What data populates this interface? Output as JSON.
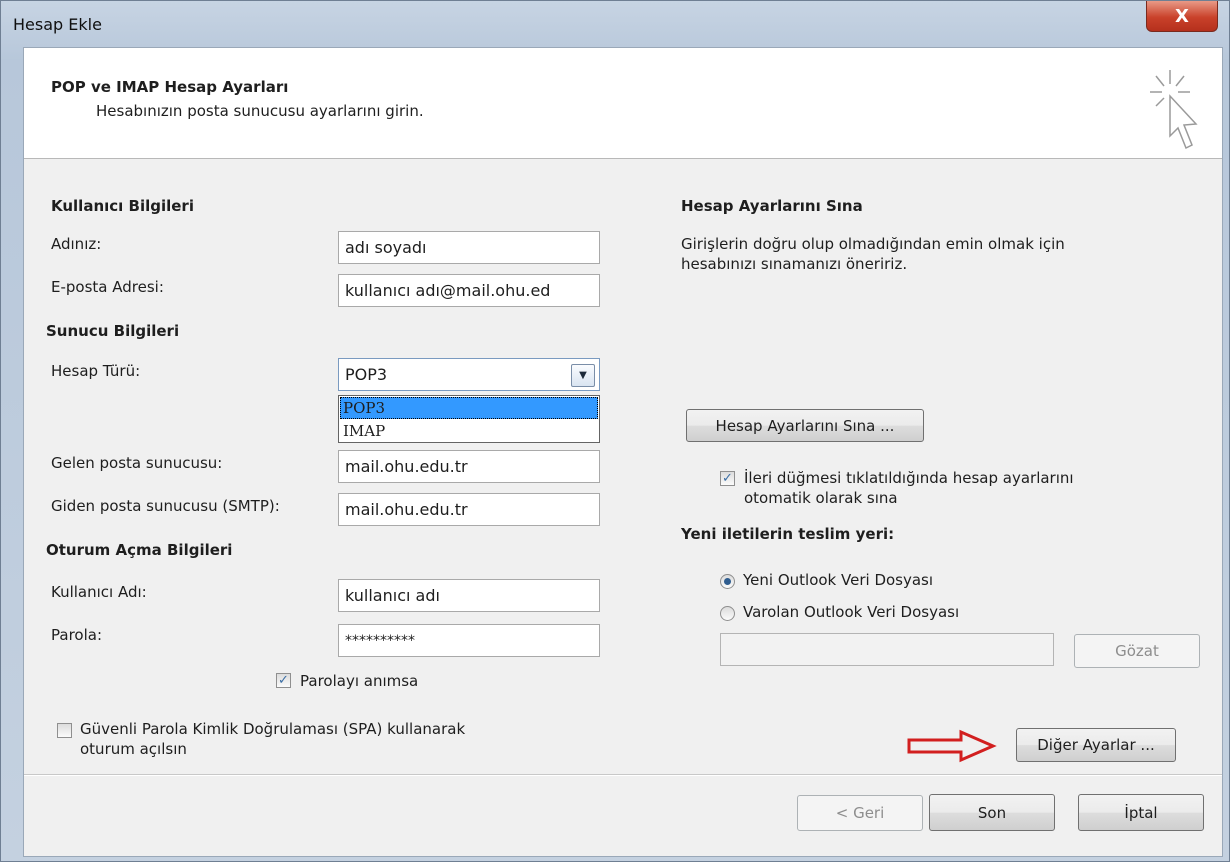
{
  "window": {
    "title": "Hesap Ekle",
    "close_label": "X"
  },
  "header": {
    "title": "POP ve IMAP Hesap Ayarları",
    "subtitle": "Hesabınızın posta sunucusu ayarlarını girin."
  },
  "user_info": {
    "heading": "Kullanıcı Bilgileri",
    "name_label": "Adınız:",
    "name_value": "adı soyadı",
    "email_label": "E-posta Adresi:",
    "email_value": "kullanıcı adı@mail.ohu.ed"
  },
  "server_info": {
    "heading": "Sunucu Bilgileri",
    "account_type_label": "Hesap Türü:",
    "account_type_value": "POP3",
    "account_type_options": [
      "POP3",
      "IMAP"
    ],
    "incoming_label": "Gelen posta sunucusu:",
    "incoming_value": "mail.ohu.edu.tr",
    "outgoing_label": "Giden posta sunucusu (SMTP):",
    "outgoing_value": "mail.ohu.edu.tr"
  },
  "logon_info": {
    "heading": "Oturum Açma Bilgileri",
    "username_label": "Kullanıcı Adı:",
    "username_value": "kullanıcı adı",
    "password_label": "Parola:",
    "password_value": "**********",
    "remember_label": "Parolayı anımsa",
    "remember_checked": true,
    "spa_label_line1": "Güvenli Parola Kimlik Doğrulaması (SPA) kullanarak",
    "spa_label_line2": "oturum açılsın",
    "spa_checked": false
  },
  "test_settings": {
    "heading": "Hesap Ayarlarını Sına",
    "description_line1": "Girişlerin doğru olup olmadığından emin olmak için",
    "description_line2": "hesabınızı sınamanızı öneririz.",
    "test_button": "Hesap Ayarlarını Sına ...",
    "auto_test_line1": "İleri düğmesi tıklatıldığında hesap ayarlarını",
    "auto_test_line2": "otomatik olarak sına",
    "auto_test_checked": true
  },
  "delivery": {
    "heading": "Yeni iletilerin teslim yeri:",
    "option_new": "Yeni Outlook Veri Dosyası",
    "option_existing": "Varolan Outlook Veri Dosyası",
    "selected": "new",
    "existing_path_value": "",
    "browse_button": "Gözat"
  },
  "more_settings_button": "Diğer Ayarlar ...",
  "footer": {
    "back": "< Geri",
    "finish": "Son",
    "cancel": "İptal"
  },
  "colors": {
    "selection": "#3399ff",
    "annotation_arrow": "#d21f1f",
    "header_bg": "#ffffff",
    "body_bg": "#f0f0f0"
  }
}
